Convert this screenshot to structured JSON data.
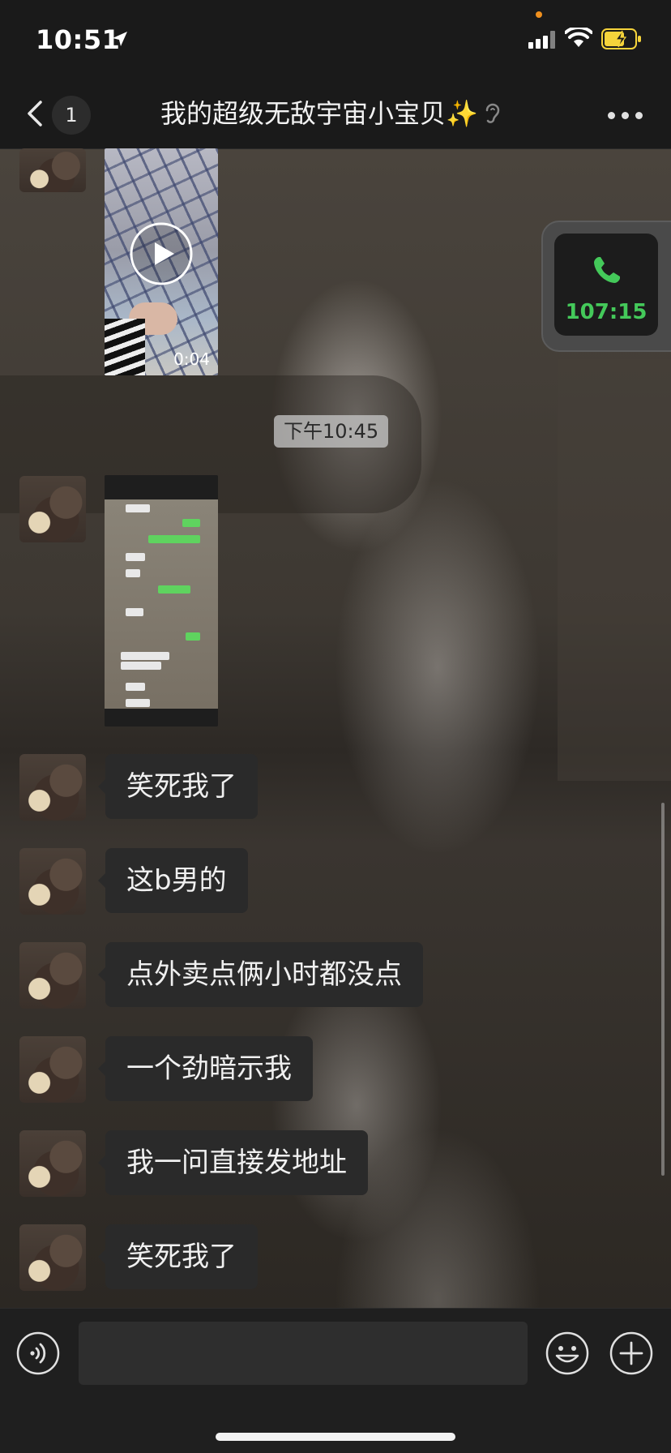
{
  "status_bar": {
    "time": "10:51"
  },
  "nav": {
    "unread_count": "1",
    "title": "我的超级无敌宇宙小宝贝",
    "title_emoji": "✨"
  },
  "messages": {
    "video": {
      "duration": "0:04"
    },
    "time_divider": "下午10:45",
    "texts": [
      "笑死我了",
      "这b男的",
      "点外卖点俩小时都没点",
      "一个劲暗示我",
      "我一问直接发地址",
      "笑死我了"
    ]
  },
  "call_float": {
    "duration": "107:15"
  },
  "input": {
    "value": ""
  },
  "colors": {
    "call_green": "#44c95a",
    "bubble": "#2a2a2a",
    "battery_yellow": "#f5d33b"
  }
}
